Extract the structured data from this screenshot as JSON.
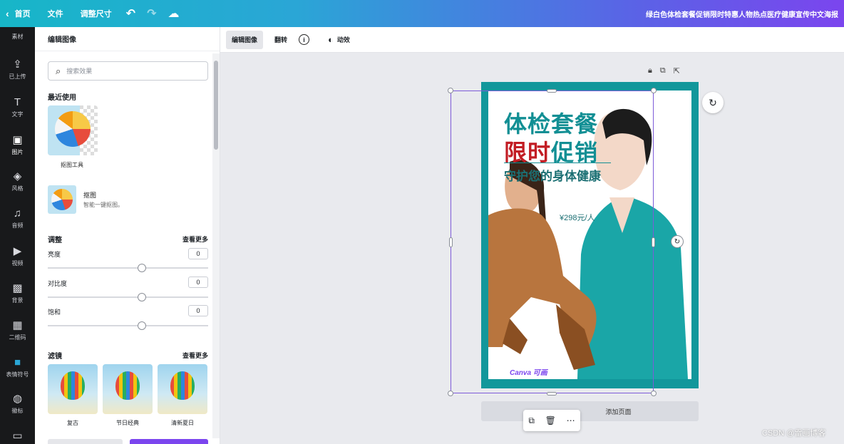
{
  "topbar": {
    "home_label": "首页",
    "file_label": "文件",
    "resize_label": "调整尺寸",
    "undo_icon": "undo-icon",
    "redo_icon": "redo-icon",
    "cloud_icon": "cloud-save-icon",
    "design_title": "绿白色体检套餐促销限时特惠人物热点医疗健康宣传中文海报"
  },
  "rail": {
    "top_label": "素材",
    "items": [
      {
        "label": "已上传",
        "icon": "upload-icon"
      },
      {
        "label": "文字",
        "icon": "text-icon"
      },
      {
        "label": "图片",
        "icon": "image-icon"
      },
      {
        "label": "风格",
        "icon": "style-icon"
      },
      {
        "label": "音频",
        "icon": "audio-icon"
      },
      {
        "label": "视频",
        "icon": "video-icon"
      },
      {
        "label": "背景",
        "icon": "background-icon"
      },
      {
        "label": "二维码",
        "icon": "qrcode-icon"
      },
      {
        "label": "表情符号",
        "icon": "emoji-icon"
      },
      {
        "label": "徽标",
        "icon": "logo-icon"
      },
      {
        "label": "",
        "icon": "folder-icon"
      }
    ]
  },
  "panel": {
    "header": "编辑图像",
    "search_placeholder": "搜索效果",
    "recent_title": "最近使用",
    "bg_remover_label": "抠图工具",
    "cutout_title": "抠图",
    "cutout_desc": "智能一键抠图。",
    "adjust_title": "调整",
    "adjust_more": "查看更多",
    "sliders": [
      {
        "label": "亮度",
        "value": "0"
      },
      {
        "label": "对比度",
        "value": "0"
      },
      {
        "label": "饱和",
        "value": "0"
      }
    ],
    "filter_title": "滤镜",
    "filter_more": "查看更多",
    "filters": [
      "复古",
      "节日经典",
      "清新夏日"
    ]
  },
  "toolbar": {
    "edit_image": "编辑图像",
    "flip": "翻转",
    "info_icon": "info-icon",
    "animate": "动效"
  },
  "poster": {
    "title_line1": "体检套餐",
    "title_line2_red": "限时",
    "title_line2_teal": "促销",
    "subtitle": "守护您的身体健康",
    "price": "¥298元/人",
    "brand": "Canva 可画",
    "frame_color": "#12979b",
    "accent_red": "#c21d24"
  },
  "canvas": {
    "add_page_label": "添加页面",
    "watermark": "CSDN @雷画博客"
  }
}
